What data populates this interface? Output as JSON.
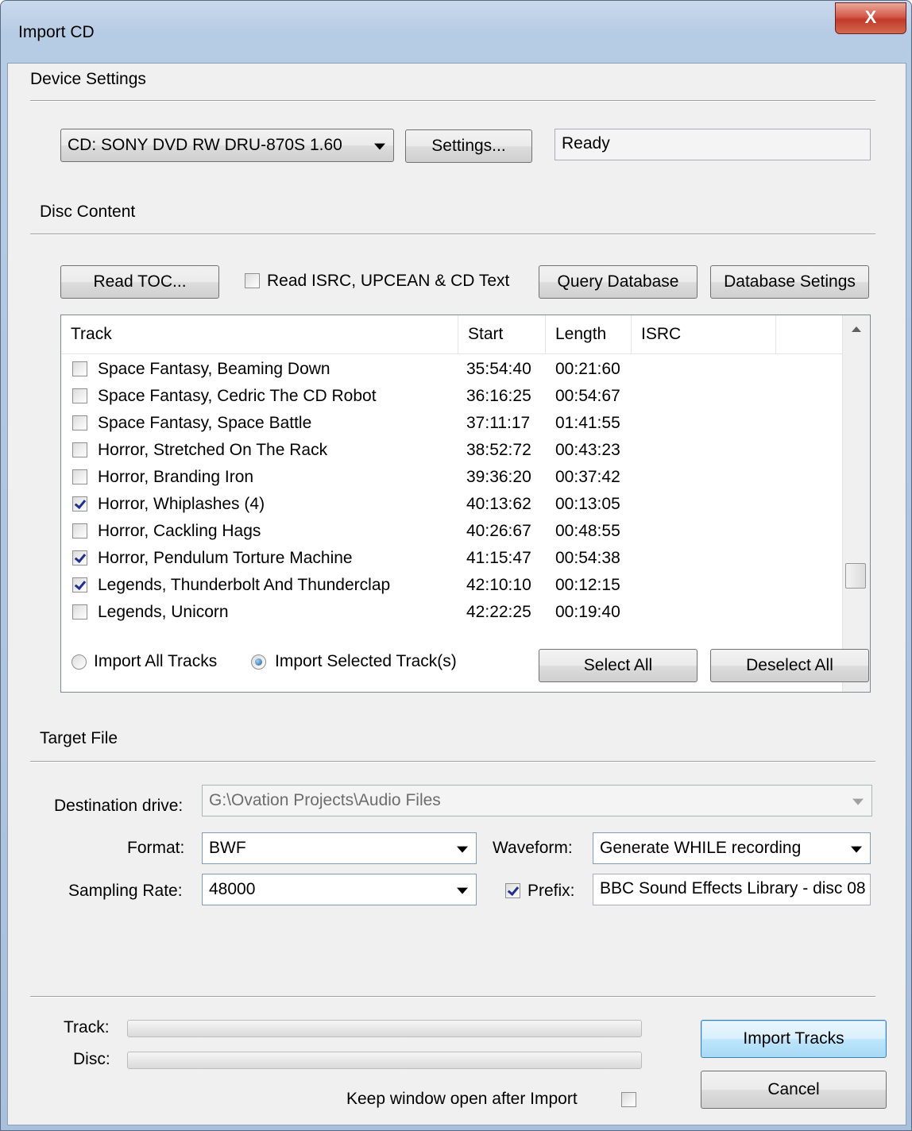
{
  "window": {
    "title": "Import CD",
    "close_glyph": "X"
  },
  "device": {
    "section_title": "Device Settings",
    "drive": "CD: SONY DVD RW DRU-870S 1.60",
    "settings_button": "Settings...",
    "status": "Ready"
  },
  "disc": {
    "section_title": "Disc Content",
    "read_toc_button": "Read TOC...",
    "read_isrc_label": "Read ISRC, UPCEAN & CD Text",
    "read_isrc_checked": false,
    "query_db_button": "Query Database",
    "db_settings_button": "Database Setings",
    "columns": {
      "track": "Track",
      "start": "Start",
      "length": "Length",
      "isrc": "ISRC"
    },
    "tracks": [
      {
        "name": "Space Fantasy, Beaming Down",
        "start": "35:54:40",
        "length": "00:21:60",
        "checked": false
      },
      {
        "name": "Space Fantasy, Cedric The CD Robot",
        "start": "36:16:25",
        "length": "00:54:67",
        "checked": false
      },
      {
        "name": "Space Fantasy, Space Battle",
        "start": "37:11:17",
        "length": "01:41:55",
        "checked": false
      },
      {
        "name": "Horror, Stretched On The Rack",
        "start": "38:52:72",
        "length": "00:43:23",
        "checked": false
      },
      {
        "name": "Horror, Branding Iron",
        "start": "39:36:20",
        "length": "00:37:42",
        "checked": false
      },
      {
        "name": "Horror, Whiplashes (4)",
        "start": "40:13:62",
        "length": "00:13:05",
        "checked": true
      },
      {
        "name": "Horror, Cackling Hags",
        "start": "40:26:67",
        "length": "00:48:55",
        "checked": false
      },
      {
        "name": "Horror, Pendulum Torture Machine",
        "start": "41:15:47",
        "length": "00:54:38",
        "checked": true
      },
      {
        "name": "Legends, Thunderbolt And Thunderclap",
        "start": "42:10:10",
        "length": "00:12:15",
        "checked": true
      },
      {
        "name": "Legends, Unicorn",
        "start": "42:22:25",
        "length": "00:19:40",
        "checked": false
      }
    ],
    "import_all_label": "Import All Tracks",
    "import_selected_label": "Import Selected Track(s)",
    "import_mode": "selected",
    "select_all_button": "Select All",
    "deselect_all_button": "Deselect All"
  },
  "target": {
    "section_title": "Target File",
    "destination_label": "Destination drive:",
    "destination_value": "G:\\Ovation Projects\\Audio Files",
    "format_label": "Format:",
    "format_value": "BWF",
    "waveform_label": "Waveform:",
    "waveform_value": "Generate WHILE recording",
    "sampling_label": "Sampling Rate:",
    "sampling_value": "48000",
    "prefix_label": "Prefix:",
    "prefix_checked": true,
    "prefix_value": "BBC Sound Effects Library - disc 08"
  },
  "footer": {
    "track_label": "Track:",
    "disc_label": "Disc:",
    "track_progress": 0,
    "disc_progress": 0,
    "keep_open_label": "Keep window open after Import",
    "keep_open_checked": false,
    "import_button": "Import Tracks",
    "cancel_button": "Cancel"
  }
}
